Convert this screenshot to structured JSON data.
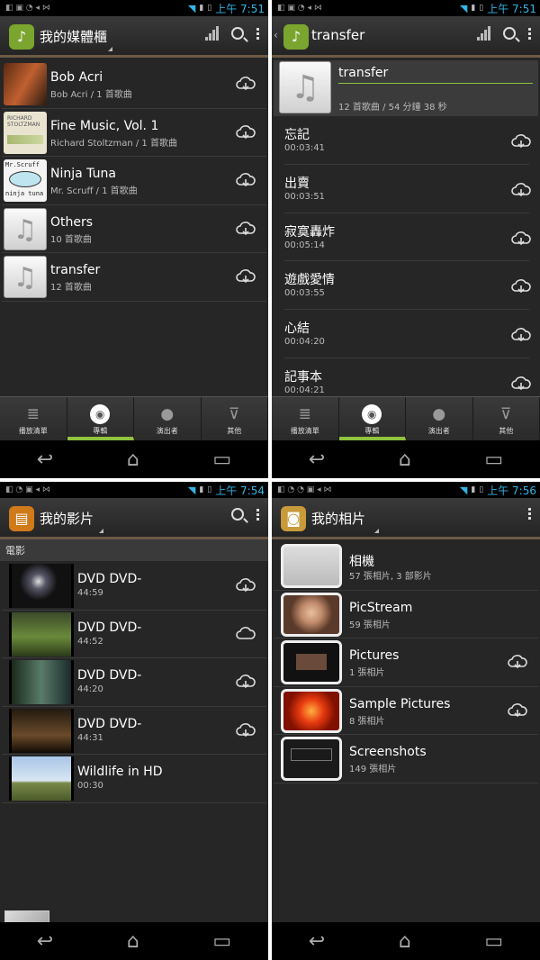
{
  "status": {
    "p1_time": "上午 7:51",
    "p2_time": "上午 7:51",
    "p3_time": "上午 7:54",
    "p4_time": "上午 7:56"
  },
  "colors": {
    "accent": "#33b5e5",
    "tab_active": "#8fc33e",
    "bar_border": "#6d5a45",
    "background": "#262626"
  },
  "music": {
    "title": "我的媒體櫃",
    "items": [
      {
        "title": "Bob Acri",
        "sub": "Bob Acri / 1 首歌曲"
      },
      {
        "title": "Fine Music, Vol. 1",
        "sub": "Richard Stoltzman / 1 首歌曲"
      },
      {
        "title": "Ninja Tuna",
        "sub": "Mr. Scruff / 1 首歌曲"
      },
      {
        "title": "Others",
        "sub": "10 首歌曲"
      },
      {
        "title": "transfer",
        "sub": "12 首歌曲"
      }
    ],
    "album_art_labels": {
      "fine_music": "RICHARD STOLTZMAN",
      "ninja_top": "Mr.Scruff",
      "ninja_bottom": "ninja tuna"
    }
  },
  "tabs": [
    "播放清單",
    "專輯",
    "演出者",
    "其他"
  ],
  "album": {
    "title": "transfer",
    "head_title": "transfer",
    "head_sub": "12 首歌曲 / 54 分鐘 38 秒",
    "tracks": [
      {
        "title": "忘記",
        "dur": "00:03:41"
      },
      {
        "title": "出賣",
        "dur": "00:03:51"
      },
      {
        "title": "寂寞轟炸",
        "dur": "00:05:14"
      },
      {
        "title": "遊戲愛情",
        "dur": "00:03:55"
      },
      {
        "title": "心結",
        "dur": "00:04:20"
      },
      {
        "title": "記事本",
        "dur": "00:04:21"
      }
    ]
  },
  "video": {
    "title": "我的影片",
    "section": "電影",
    "items": [
      {
        "title": "DVD DVD-",
        "dur": "44:59"
      },
      {
        "title": "DVD DVD-",
        "dur": "44:52"
      },
      {
        "title": "DVD DVD-",
        "dur": "44:20"
      },
      {
        "title": "DVD DVD-",
        "dur": "44:31"
      },
      {
        "title": "Wildlife in HD",
        "dur": "00:30"
      }
    ]
  },
  "photos": {
    "title": "我的相片",
    "items": [
      {
        "title": "相機",
        "sub": "57 張相片, 3 部影片"
      },
      {
        "title": "PicStream",
        "sub": "59 張相片"
      },
      {
        "title": "Pictures",
        "sub": "1 張相片"
      },
      {
        "title": "Sample Pictures",
        "sub": "8 張相片"
      },
      {
        "title": "Screenshots",
        "sub": "149 張相片"
      }
    ]
  },
  "icons": {
    "app_music": "music-note-icon",
    "app_video": "clapperboard-icon",
    "app_photo": "photo-icon",
    "cloud": "cloud-download-icon"
  }
}
